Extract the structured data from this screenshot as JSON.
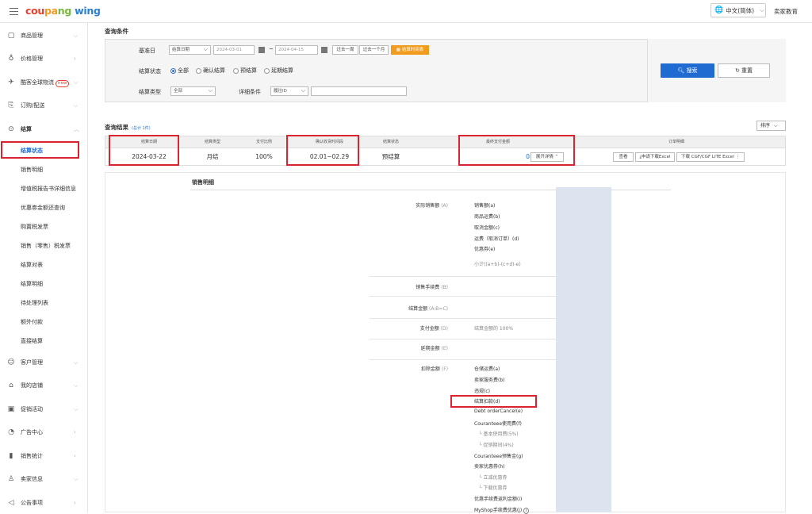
{
  "header": {
    "logo": [
      "cou",
      "pa",
      "ng",
      "wing"
    ],
    "lang": "中文(简体)",
    "seller_edu": "卖家教育"
  },
  "sidebar": {
    "items": [
      {
        "label": "商品管理",
        "icon": "product-icon"
      },
      {
        "label": "价格管理",
        "icon": "price-icon"
      },
      {
        "label": "酷客全球物流",
        "icon": "logistics-icon",
        "badge": "new"
      },
      {
        "label": "订购/配送",
        "icon": "order-icon"
      },
      {
        "label": "结算",
        "icon": "settlement-icon",
        "expanded": true
      }
    ],
    "sub_items": [
      "结算状态",
      "销售明细",
      "增值税报告书详细信息",
      "优惠劵金额还查询",
      "购置税发票",
      "销售（零售）税发票",
      "结算对表",
      "结算明细",
      "待处理列表",
      "额外付款",
      "直接结算"
    ],
    "items2": [
      {
        "label": "客户管理",
        "icon": "customer-icon"
      },
      {
        "label": "我的店铺",
        "icon": "store-icon"
      },
      {
        "label": "促销活动",
        "icon": "promo-icon"
      },
      {
        "label": "广告中心",
        "icon": "ad-icon"
      },
      {
        "label": "销售统计",
        "icon": "stats-icon"
      },
      {
        "label": "卖家信息",
        "icon": "seller-icon"
      },
      {
        "label": "公告事项",
        "icon": "notice-icon"
      }
    ]
  },
  "query": {
    "title": "查询条件",
    "base_date_label": "基准日",
    "base_date_type": "结算日期",
    "date_from": "2024-03-01",
    "date_sep": "~",
    "date_to": "2024-04-15",
    "btn_week": "过去一周",
    "btn_month": "过去一个月",
    "btn_schedule": "结算时间表",
    "status_label": "结算状态",
    "status_options": [
      "全部",
      "确认结算",
      "预结算",
      "延期结算"
    ],
    "type_label": "结算类型",
    "type_value": "全部",
    "detail_label": "详细条件",
    "detail_value": "履往ID",
    "search_btn": "搜索",
    "reset_btn": "重置"
  },
  "result": {
    "title": "查询结果",
    "count": "(总计 1件)",
    "sort": "排序",
    "headers": [
      "结算日期",
      "结算类型",
      "支付比例",
      "确认收货时间段",
      "结算状态",
      "最终支付金额",
      "订单明细"
    ],
    "row": {
      "date": "2024-03-22",
      "type": "月结",
      "ratio": "100%",
      "period": "02.01~02.29",
      "status": "预结算",
      "amount": "0",
      "expand": "展开详情",
      "btn_view": "查看",
      "btn_excel": "申请下载Excel",
      "btn_cgf": "下载 CGF/CGF LITE Excel"
    }
  },
  "detail": {
    "title": "销售明细",
    "actual_sales": {
      "label": "实际销售额",
      "code": "(A)",
      "items": [
        "销售额(a)",
        "商品运费(b)",
        "取消金额(c)",
        "运费（取消订单）(d)",
        "优惠券(e)"
      ],
      "subtotal": "小计((a+b)-(c+d)-e)"
    },
    "commission": {
      "label": "销售手续费",
      "code": "(B)"
    },
    "settle_amount": {
      "label": "结算金额",
      "code": "(A-B=C)"
    },
    "payment": {
      "label": "支付金额",
      "code": "(D)",
      "note": "结算金额的 100%"
    },
    "deferred": {
      "label": "延期金额",
      "code": "(E)"
    },
    "deduction": {
      "label": "扣除金额",
      "code": "(F)",
      "items": [
        "仓储运费(a)",
        "卖家服务费(b)",
        "违规(c)",
        "结算扣款(d)",
        "Debt orderCancel(e)",
        "Couranteee使用费(f)",
        "└ 基本使用费(5%)",
        "└ 促销期间(4%)",
        "Couranteee预售金(g)",
        "卖家优惠券(h)",
        "└ 立减优惠券",
        "└ 下载优惠券",
        "优惠手续费返利金额(i)",
        "MyShop手续费优惠(j)"
      ]
    }
  },
  "colors": {
    "accent": "#1f6bd2",
    "highlight": "#d9232f",
    "schedule_btn": "#f29c1f"
  }
}
